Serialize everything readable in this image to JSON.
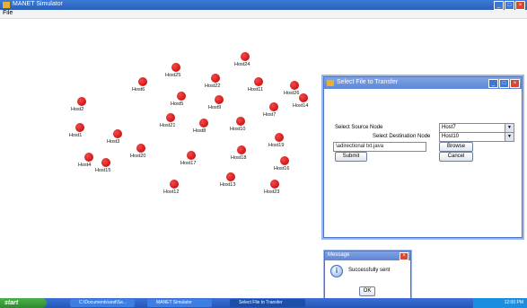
{
  "window": {
    "title": "MANET Simulator",
    "menu_file": "File"
  },
  "nodes": [
    {
      "name": "Host24"
    },
    {
      "name": "Host25"
    },
    {
      "name": "Host22"
    },
    {
      "name": "Host6"
    },
    {
      "name": "Host11"
    },
    {
      "name": "Host26"
    },
    {
      "name": "Host2"
    },
    {
      "name": "Host5"
    },
    {
      "name": "Host9"
    },
    {
      "name": "Host7"
    },
    {
      "name": "Host1"
    },
    {
      "name": "Host3"
    },
    {
      "name": "Host21"
    },
    {
      "name": "Host8"
    },
    {
      "name": "Host10"
    },
    {
      "name": "Host19"
    },
    {
      "name": "Host4"
    },
    {
      "name": "Host20"
    },
    {
      "name": "Host15"
    },
    {
      "name": "Host17"
    },
    {
      "name": "Host18"
    },
    {
      "name": "Host16"
    },
    {
      "name": "Host13"
    },
    {
      "name": "Host12"
    },
    {
      "name": "Host23"
    },
    {
      "name": "Host14"
    }
  ],
  "transfer_dialog": {
    "title": "Select File to Transfer",
    "source_label": "Select Source Node",
    "source_value": "Host7",
    "dest_label": "Select Destination Node",
    "dest_value": "Host10",
    "file_path": "\\adirectional txt.java",
    "browse_label": "Browse",
    "submit_label": "Submit",
    "cancel_label": "Cancel"
  },
  "message_dialog": {
    "title": "Message",
    "text": "Successfully sent",
    "ok_label": "OK",
    "icon": "info-icon"
  },
  "taskbar": {
    "start_label": "start",
    "tasks": [
      "C:\\Documents\\and\\Se...",
      "MANET Simulator",
      "Select File to Transfer"
    ],
    "clock": "12:00 PM"
  },
  "colors": {
    "title_bar": "#2a5fb8",
    "node": "#d80000",
    "taskbar": "#2356b7",
    "start": "#2e8a2e"
  }
}
